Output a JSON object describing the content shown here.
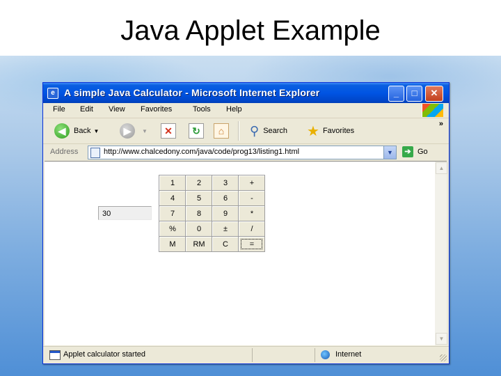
{
  "slide": {
    "title": "Java Applet Example"
  },
  "window": {
    "title": "A simple Java Calculator - Microsoft Internet Explorer",
    "app_icon": "e",
    "controls": {
      "minimize": "_",
      "maximize": "□",
      "close": "✕"
    }
  },
  "menu": [
    "File",
    "Edit",
    "View",
    "Favorites",
    "Tools",
    "Help"
  ],
  "toolbar": {
    "back_label": "Back",
    "search_label": "Search",
    "favorites_label": "Favorites",
    "more": "»",
    "icons": [
      "back-arrow-icon",
      "forward-arrow-icon",
      "stop-icon",
      "refresh-icon",
      "home-icon",
      "search-icon",
      "favorites-star-icon"
    ]
  },
  "address": {
    "label": "Address",
    "url": "http://www.chalcedony.com/java/code/prog13/listing1.html",
    "go_label": "Go"
  },
  "calculator": {
    "display": "30",
    "keys": [
      [
        "1",
        "2",
        "3",
        "+"
      ],
      [
        "4",
        "5",
        "6",
        "-"
      ],
      [
        "7",
        "8",
        "9",
        "*"
      ],
      [
        "%",
        "0",
        "±",
        "/"
      ],
      [
        "M",
        "RM",
        "C",
        "="
      ]
    ]
  },
  "status": {
    "text": "Applet calculator started",
    "zone": "Internet"
  },
  "colors": {
    "titlebar": "#0054e3",
    "chrome": "#ece9d8",
    "slide_gradient_bottom": "#4f8fd6"
  }
}
